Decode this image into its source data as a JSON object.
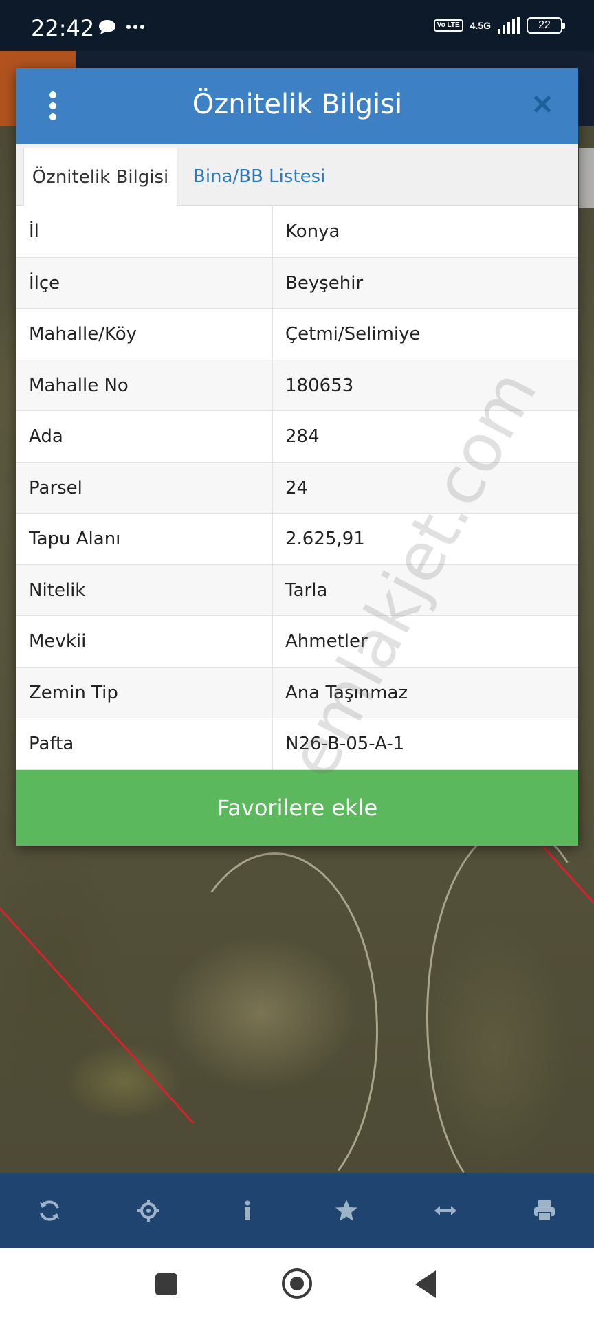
{
  "status_bar": {
    "time": "22:42",
    "notification_icons": [
      "chat-bubble-icon",
      "more-dots-icon"
    ],
    "volte": "Vo LTE",
    "network": "4.5G",
    "battery": "22"
  },
  "dialog": {
    "title": "Öznitelik Bilgisi",
    "menu_icon": "kebab-menu-icon",
    "close_icon": "close-icon",
    "tabs": [
      {
        "label": "Öznitelik Bilgisi",
        "active": true
      },
      {
        "label": "Bina/BB Listesi",
        "active": false
      }
    ],
    "rows": [
      {
        "key": "İl",
        "value": "Konya"
      },
      {
        "key": "İlçe",
        "value": "Beyşehir"
      },
      {
        "key": "Mahalle/Köy",
        "value": "Çetmi/Selimiye"
      },
      {
        "key": "Mahalle No",
        "value": "180653"
      },
      {
        "key": "Ada",
        "value": "284"
      },
      {
        "key": "Parsel",
        "value": "24"
      },
      {
        "key": "Tapu Alanı",
        "value": "2.625,91"
      },
      {
        "key": "Nitelik",
        "value": "Tarla"
      },
      {
        "key": "Mevkii",
        "value": "Ahmetler"
      },
      {
        "key": "Zemin Tip",
        "value": "Ana Taşınmaz"
      },
      {
        "key": "Pafta",
        "value": "N26-B-05-A-1"
      }
    ],
    "favorite_button": "Favorilere ekle",
    "watermark": "emlakjet.com"
  },
  "toolbar": {
    "buttons": [
      "refresh-icon",
      "locate-icon",
      "info-icon",
      "star-icon",
      "measure-icon",
      "print-icon"
    ]
  },
  "colors": {
    "header": "#3d80c4",
    "favorite": "#5cb85c",
    "toolbar": "#1f4470",
    "tab_link": "#2f79b8"
  }
}
